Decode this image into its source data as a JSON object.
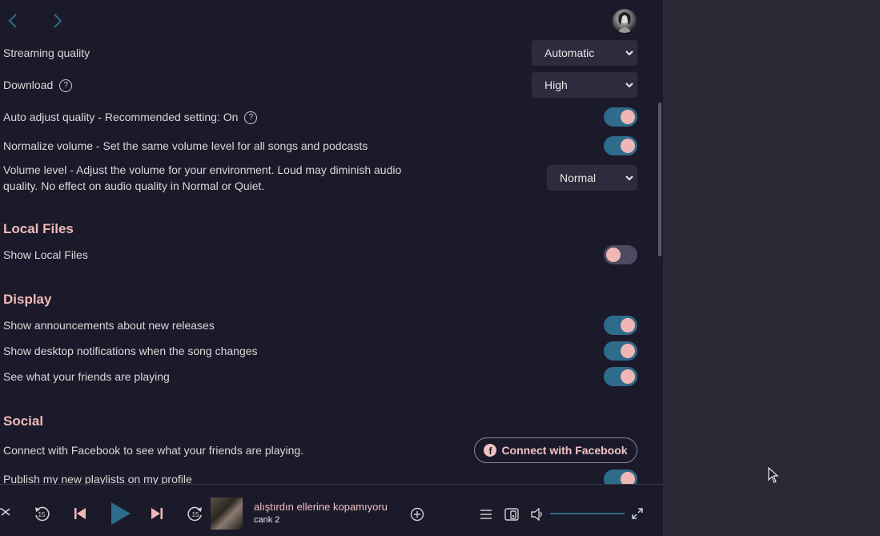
{
  "colors": {
    "accent": "#2f6b8a",
    "pink": "#f0b9b8",
    "background": "#1b1a2a"
  },
  "settings": {
    "streaming_quality": {
      "label": "Streaming quality",
      "value": "Automatic"
    },
    "download": {
      "label": "Download",
      "value": "High"
    },
    "auto_adjust": {
      "label": "Auto adjust quality - Recommended setting: On",
      "on": true
    },
    "normalize": {
      "label": "Normalize volume - Set the same volume level for all songs and podcasts",
      "on": true
    },
    "volume_level": {
      "label": "Volume level - Adjust the volume for your environment. Loud may diminish audio quality. No effect on audio quality in Normal or Quiet.",
      "value": "Normal"
    },
    "local_files": {
      "title": "Local Files",
      "show_local": {
        "label": "Show Local Files",
        "on": false
      }
    },
    "display": {
      "title": "Display",
      "announcements": {
        "label": "Show announcements about new releases",
        "on": true
      },
      "notifications": {
        "label": "Show desktop notifications when the song changes",
        "on": true
      },
      "friends": {
        "label": "See what your friends are playing",
        "on": true
      }
    },
    "social": {
      "title": "Social",
      "facebook_text": "Connect with Facebook to see what your friends are playing.",
      "facebook_button": "Connect with Facebook",
      "publish": {
        "label": "Publish my new playlists on my profile",
        "on": true
      }
    }
  },
  "player": {
    "track_title": "alıştırdın ellerine kopamıyoru",
    "artist": "cank 2",
    "skip_back_seconds": "15",
    "skip_forward_seconds": "15",
    "volume_fraction": 1.0
  }
}
